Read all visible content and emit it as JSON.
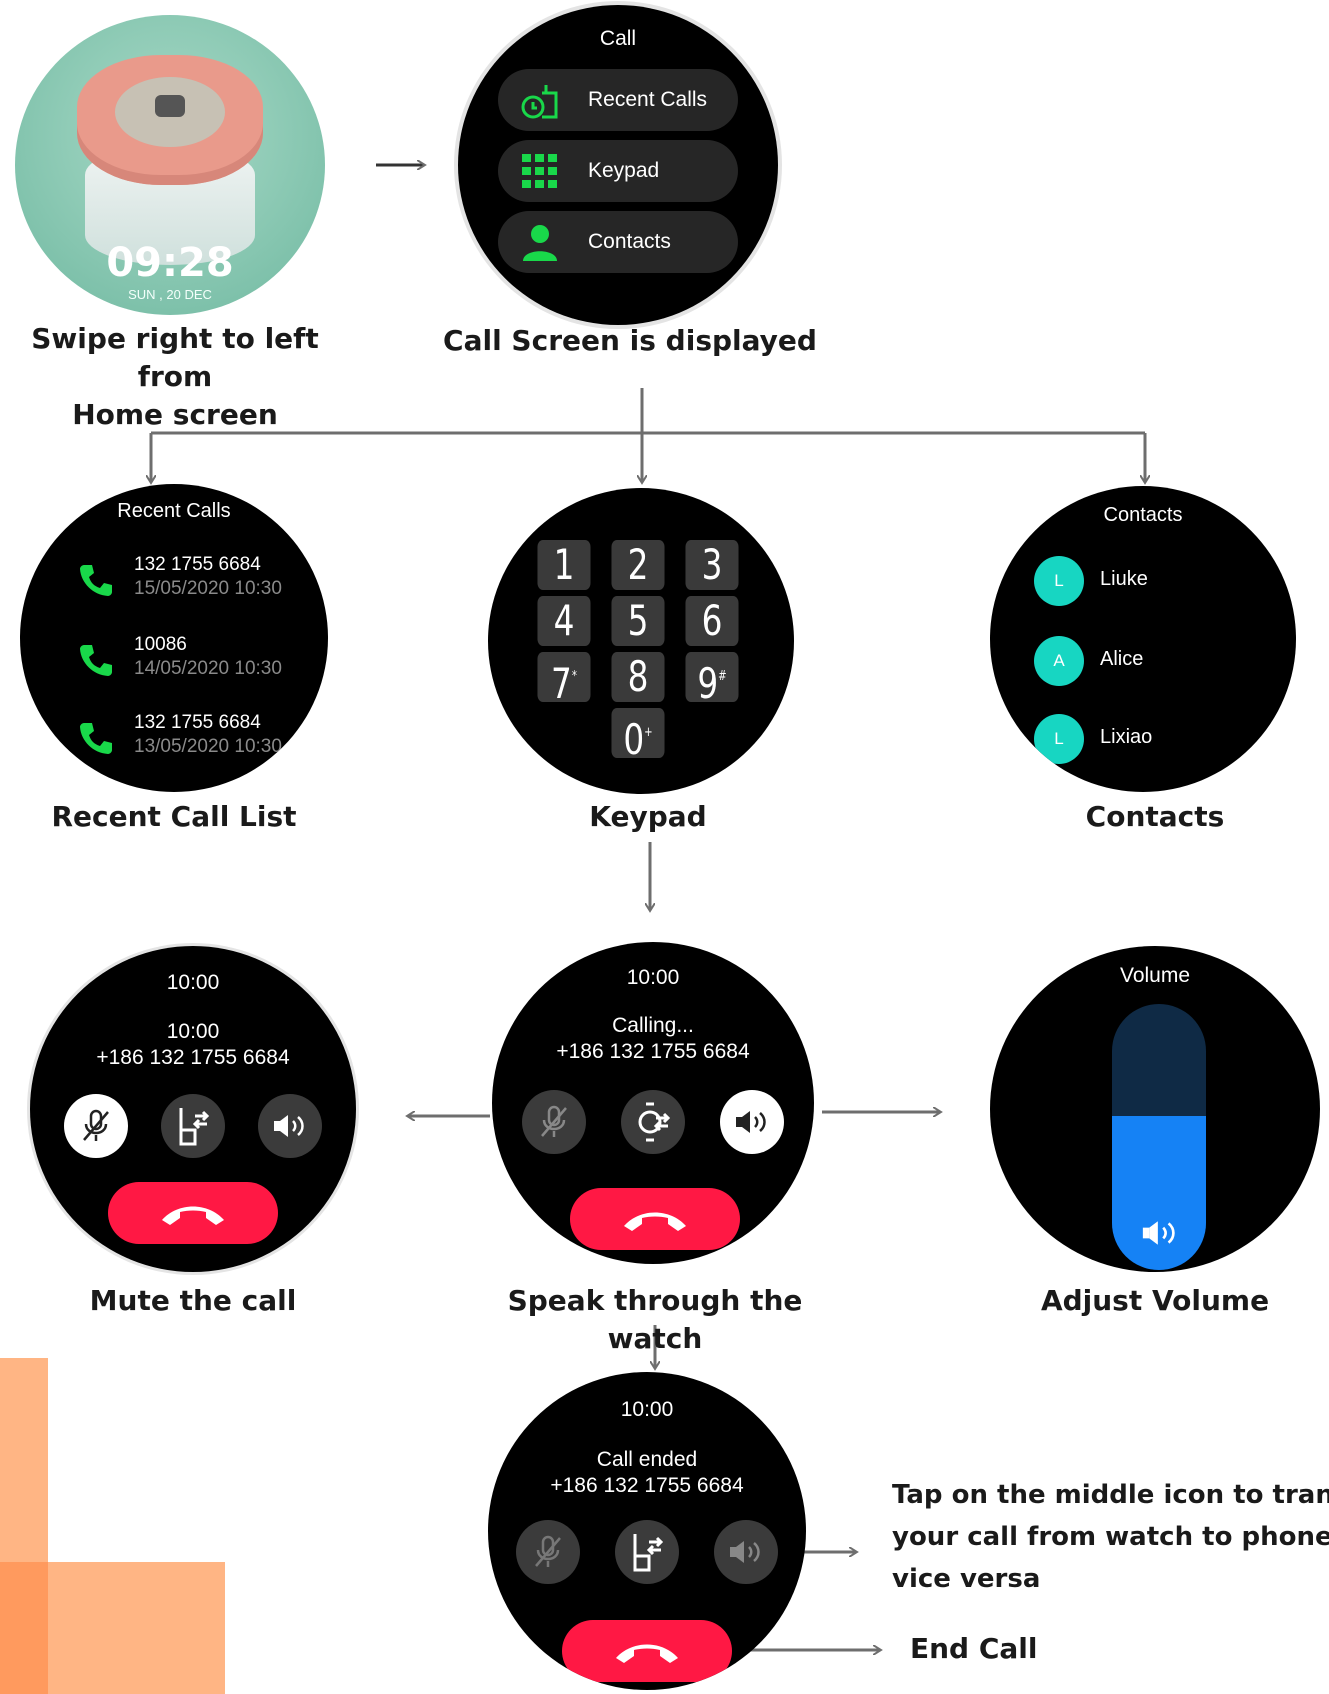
{
  "home": {
    "time": "09:28",
    "date": "SUN , 20 DEC",
    "caption_line1": "Swipe right to left from",
    "caption_line2": "Home screen"
  },
  "call_screen": {
    "title": "Call",
    "items": [
      {
        "label": "Recent Calls",
        "icon": "recent-calls-icon"
      },
      {
        "label": "Keypad",
        "icon": "keypad-icon"
      },
      {
        "label": "Contacts",
        "icon": "contact-icon"
      }
    ],
    "caption": "Call Screen is displayed"
  },
  "recent_calls": {
    "title": "Recent Calls",
    "rows": [
      {
        "number": "132 1755 6684",
        "datetime": "15/05/2020 10:30"
      },
      {
        "number": "10086",
        "datetime": "14/05/2020 10:30"
      },
      {
        "number": "132 1755 6684",
        "datetime": "13/05/2020 10:30"
      }
    ],
    "caption": "Recent Call List"
  },
  "keypad": {
    "keys": [
      {
        "main": "1",
        "sup": ""
      },
      {
        "main": "2",
        "sup": ""
      },
      {
        "main": "3",
        "sup": ""
      },
      {
        "main": "4",
        "sup": ""
      },
      {
        "main": "5",
        "sup": ""
      },
      {
        "main": "6",
        "sup": ""
      },
      {
        "main": "7",
        "sup": "*"
      },
      {
        "main": "8",
        "sup": ""
      },
      {
        "main": "9",
        "sup": "#"
      },
      {
        "main": "0",
        "sup": "+"
      }
    ],
    "caption": "Keypad"
  },
  "contacts": {
    "title": "Contacts",
    "rows": [
      {
        "initial": "L",
        "name": "Liuke"
      },
      {
        "initial": "A",
        "name": "Alice"
      },
      {
        "initial": "L",
        "name": "Lixiao"
      }
    ],
    "caption": "Contacts"
  },
  "mute": {
    "clock": "10:00",
    "status": "10:00",
    "number": "+186 132 1755 6684",
    "caption": "Mute the call"
  },
  "speak": {
    "clock": "10:00",
    "status": "Calling...",
    "number": "+186 132 1755 6684",
    "caption": "Speak through the watch"
  },
  "volume": {
    "title": "Volume",
    "level": 0.58,
    "caption": "Adjust Volume"
  },
  "ended": {
    "clock": "10:00",
    "status": "Call ended",
    "number": "+186 132 1755 6684",
    "note_line1": "Tap on the middle icon to tran",
    "note_line2": "your call from watch to phone",
    "note_line3": "vice versa",
    "end_label": "End Call"
  },
  "colors": {
    "accent_green": "#19d84a",
    "end_red": "#ff1844",
    "avatar_teal": "#17d6c2",
    "volume_blue": "#1582f5",
    "volume_dark": "#0f2a45",
    "deco_orange": "#ffb584"
  }
}
